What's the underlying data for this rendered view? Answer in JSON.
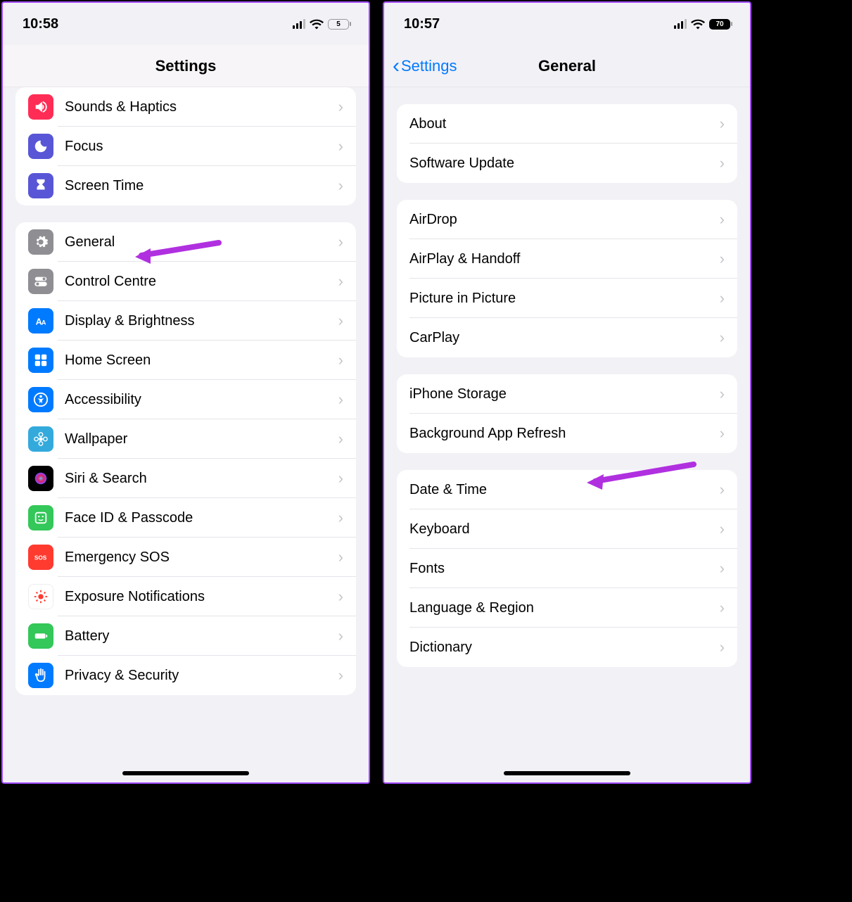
{
  "left": {
    "status": {
      "time": "10:58",
      "battery": "5"
    },
    "nav": {
      "title": "Settings"
    },
    "group1": [
      {
        "label": "Sounds & Haptics",
        "icon": "speaker",
        "bg": "bg-pink"
      },
      {
        "label": "Focus",
        "icon": "moon",
        "bg": "bg-purple"
      },
      {
        "label": "Screen Time",
        "icon": "hourglass",
        "bg": "bg-purple"
      }
    ],
    "group2": [
      {
        "label": "General",
        "icon": "gear",
        "bg": "bg-gray"
      },
      {
        "label": "Control Centre",
        "icon": "toggles",
        "bg": "bg-gray"
      },
      {
        "label": "Display & Brightness",
        "icon": "aa",
        "bg": "bg-blue"
      },
      {
        "label": "Home Screen",
        "icon": "grid",
        "bg": "bg-blue"
      },
      {
        "label": "Accessibility",
        "icon": "access",
        "bg": "bg-blue"
      },
      {
        "label": "Wallpaper",
        "icon": "flower",
        "bg": "bg-cyan"
      },
      {
        "label": "Siri & Search",
        "icon": "siri",
        "bg": "bg-black"
      },
      {
        "label": "Face ID & Passcode",
        "icon": "face",
        "bg": "bg-green"
      },
      {
        "label": "Emergency SOS",
        "icon": "sos",
        "bg": "bg-red"
      },
      {
        "label": "Exposure Notifications",
        "icon": "exposure",
        "bg": "bg-white"
      },
      {
        "label": "Battery",
        "icon": "battery",
        "bg": "bg-green"
      },
      {
        "label": "Privacy & Security",
        "icon": "hand",
        "bg": "bg-blue"
      }
    ]
  },
  "right": {
    "status": {
      "time": "10:57",
      "battery": "70"
    },
    "nav": {
      "back": "Settings",
      "title": "General"
    },
    "group1": [
      {
        "label": "About"
      },
      {
        "label": "Software Update"
      }
    ],
    "group2": [
      {
        "label": "AirDrop"
      },
      {
        "label": "AirPlay & Handoff"
      },
      {
        "label": "Picture in Picture"
      },
      {
        "label": "CarPlay"
      }
    ],
    "group3": [
      {
        "label": "iPhone Storage"
      },
      {
        "label": "Background App Refresh"
      }
    ],
    "group4": [
      {
        "label": "Date & Time"
      },
      {
        "label": "Keyboard"
      },
      {
        "label": "Fonts"
      },
      {
        "label": "Language & Region"
      },
      {
        "label": "Dictionary"
      }
    ]
  }
}
